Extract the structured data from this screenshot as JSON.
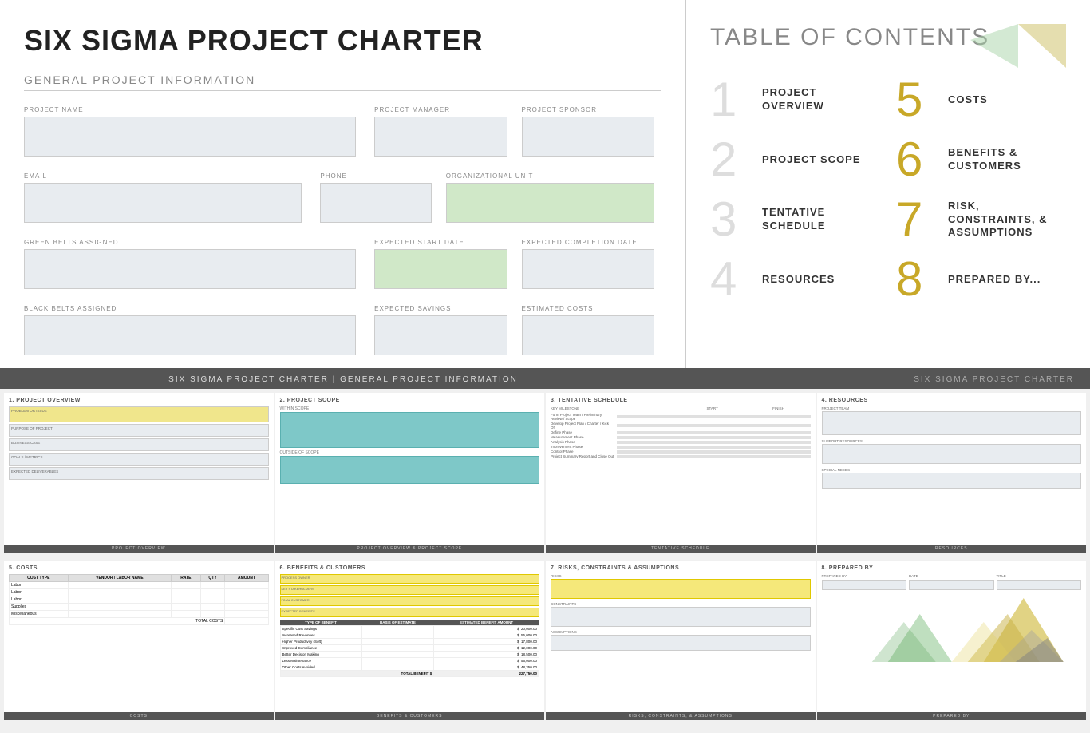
{
  "charter": {
    "title": "SIX SIGMA PROJECT CHARTER",
    "gpi_header": "GENERAL PROJECT INFORMATION",
    "fields": {
      "project_name": "PROJECT NAME",
      "project_manager": "PROJECT MANAGER",
      "project_sponsor": "PROJECT SPONSOR",
      "email": "EMAIL",
      "phone": "PHONE",
      "org_unit": "ORGANIZATIONAL UNIT",
      "green_belts": "GREEN BELTS ASSIGNED",
      "expected_start": "EXPECTED START DATE",
      "expected_completion": "EXPECTED COMPLETION DATE",
      "black_belts": "BLACK BELTS ASSIGNED",
      "expected_savings": "EXPECTED SAVINGS",
      "estimated_costs": "ESTIMATED COSTS"
    }
  },
  "toc": {
    "title": "TABLE OF CONTENTS",
    "items": [
      {
        "num": "1",
        "label": "PROJECT OVERVIEW"
      },
      {
        "num": "5",
        "label": "COSTS"
      },
      {
        "num": "2",
        "label": "PROJECT SCOPE"
      },
      {
        "num": "6",
        "label": "BENEFITS & CUSTOMERS"
      },
      {
        "num": "3",
        "label": "TENTATIVE SCHEDULE"
      },
      {
        "num": "7",
        "label": "RISK, CONSTRAINTS, & ASSUMPTIONS"
      },
      {
        "num": "4",
        "label": "RESOURCES"
      },
      {
        "num": "8",
        "label": "PREPARED BY..."
      }
    ]
  },
  "banner": {
    "center": "SIX SIGMA PROJECT CHARTER   |   GENERAL PROJECT INFORMATION",
    "right": "SIX SIGMA PROJECT CHARTER"
  },
  "thumbnails": [
    {
      "id": "overview",
      "title": "1. PROJECT OVERVIEW",
      "banner": "PROJECT OVERVIEW",
      "items": [
        "PROBLEM OR ISSUE",
        "PURPOSE OF PROJECT",
        "BUSINESS CASE",
        "GOALS / METRICS",
        "EXPECTED DELIVERABLES"
      ]
    },
    {
      "id": "scope",
      "title": "2. PROJECT SCOPE",
      "banner": "PROJECT OVERVIEW & PROJECT SCOPE",
      "within": "WITHIN SCOPE",
      "outside": "OUTSIDE OF SCOPE"
    },
    {
      "id": "schedule",
      "title": "3. TENTATIVE SCHEDULE",
      "banner": "TENTATIVE SCHEDULE",
      "rows": [
        "Form Project Team / Preliminary Review / Scope",
        "Develop Project Plan / Charter / Kick Off",
        "Define Phase",
        "Measurement Phase",
        "Analysis Phase",
        "Improvement Phase",
        "Control Phase",
        "Project Summary Report and Close Out"
      ]
    },
    {
      "id": "resources",
      "title": "4. RESOURCES",
      "banner": "RESOURCES",
      "items": [
        "PROJECT TEAM",
        "SUPPORT RESOURCES",
        "SPECIAL NEEDS"
      ]
    }
  ],
  "bottom_thumbnails": [
    {
      "id": "costs",
      "title": "5. COSTS",
      "banner": "COSTS",
      "columns": [
        "COST TYPE",
        "VENDOR / LABOR NAME",
        "RATE",
        "QTY",
        "AMOUNT"
      ],
      "rows": [
        "Labor",
        "Labor",
        "Labor",
        "Supplies",
        "Miscellaneous"
      ],
      "total": "TOTAL COSTS"
    },
    {
      "id": "benefits",
      "title": "6. BENEFITS & CUSTOMERS",
      "banner": "BENEFITS & CUSTOMERS",
      "labels": [
        "PROCESS OWNER",
        "KEY STAKEHOLDERS",
        "FINAL CUSTOMER",
        "EXPECTED BENEFITS"
      ],
      "table_cols": [
        "TYPE OF BENEFIT",
        "BASIS OF ESTIMATE",
        "ESTIMATED BENEFIT AMOUNT"
      ],
      "table_rows": [
        {
          "type": "Specific Cost Savings",
          "amount": "20,000.00"
        },
        {
          "type": "Increased Revenues",
          "amount": "55,000.00"
        },
        {
          "type": "Higher Productivity (Soft)",
          "amount": "17,800.00"
        },
        {
          "type": "Improved Compliance",
          "amount": "12,000.00"
        },
        {
          "type": "Better Decision Making",
          "amount": "18,500.00"
        },
        {
          "type": "Less Maintenance",
          "amount": "56,000.00"
        },
        {
          "type": "Other Costs Avoided",
          "amount": "48,350.00"
        }
      ],
      "total": "227,750.00"
    },
    {
      "id": "risks",
      "title": "7. RISKS, CONSTRAINTS & ASSUMPTIONS",
      "banner": "RISKS, CONSTRAINTS, & ASSUMPTIONS",
      "labels": [
        "RISKS",
        "CONSTRAINTS",
        "ASSUMPTIONS"
      ]
    },
    {
      "id": "prepared",
      "title": "8. PREPARED BY",
      "banner": "PREPARED BY",
      "columns": [
        "PREPARED BY",
        "DATE",
        "TITLE"
      ]
    }
  ]
}
